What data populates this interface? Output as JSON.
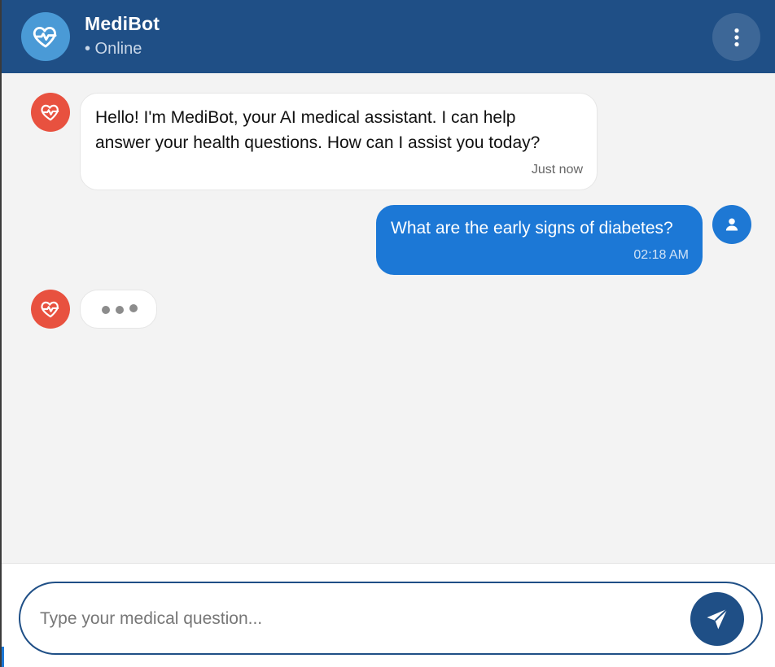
{
  "header": {
    "title": "MediBot",
    "status": "• Online",
    "avatar_icon": "heart-pulse-icon",
    "menu_icon": "more-vertical-icon"
  },
  "messages": [
    {
      "sender": "bot",
      "text_line1": "Hello! I'm MediBot, your AI medical assistant. I can help",
      "text_line2": "answer your health questions. How can I assist you today?",
      "time": "Just now"
    },
    {
      "sender": "user",
      "text": "What are the early signs of diabetes?",
      "time": "02:18 AM"
    }
  ],
  "typing_indicator": {
    "sender": "bot"
  },
  "composer": {
    "placeholder": "Type your medical question...",
    "value": "",
    "send_icon": "send-icon"
  },
  "colors": {
    "header_bg": "#1f4f86",
    "bot_avatar": "#e8513f",
    "user_bubble": "#1c78d6",
    "chat_bg": "#f3f3f3"
  }
}
